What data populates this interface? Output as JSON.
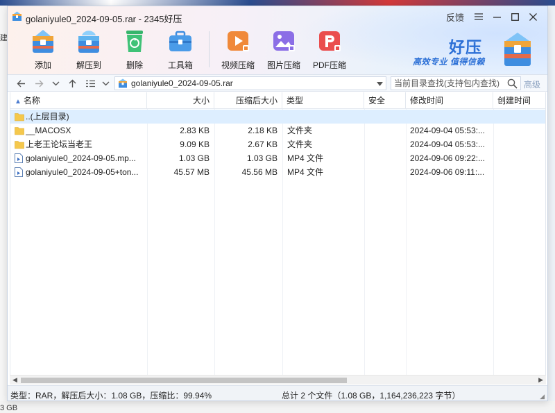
{
  "desktop": {
    "left_text": "建",
    "bottom_text": "3 GB"
  },
  "window": {
    "title": "golaniyule0_2024-09-05.rar - 2345好压",
    "feedback": "反馈"
  },
  "toolbar": {
    "items": [
      {
        "label": "添加",
        "icon": "add-archive-icon"
      },
      {
        "label": "解压到",
        "icon": "extract-icon"
      },
      {
        "label": "删除",
        "icon": "recycle-delete-icon"
      },
      {
        "label": "工具箱",
        "icon": "toolbox-icon"
      },
      {
        "label": "视频压缩",
        "icon": "video-compress-icon"
      },
      {
        "label": "图片压缩",
        "icon": "image-compress-icon"
      },
      {
        "label": "PDF压缩",
        "icon": "pdf-compress-icon"
      }
    ]
  },
  "brand": {
    "name": "好压",
    "slogan": "高效专业  值得信赖"
  },
  "addressbar": {
    "path": "golaniyule0_2024-09-05.rar",
    "search_placeholder": "当前目录查找(支持包内查找)",
    "advanced": "高级"
  },
  "columns": {
    "name": "名称",
    "size": "大小",
    "packed": "压缩后大小",
    "type": "类型",
    "security": "安全",
    "modified": "修改时间",
    "created": "创建时间"
  },
  "rows": [
    {
      "icon": "folder",
      "name": "..(上层目录)",
      "size": "",
      "packed": "",
      "type": "",
      "security": "",
      "modified": "",
      "created": ""
    },
    {
      "icon": "folder",
      "name": "__MACOSX",
      "size": "2.83 KB",
      "packed": "2.18 KB",
      "type": "文件夹",
      "security": "",
      "modified": "2024-09-04 05:53:...",
      "created": ""
    },
    {
      "icon": "folder",
      "name": "上老王论坛当老王",
      "size": "9.09 KB",
      "packed": "2.67 KB",
      "type": "文件夹",
      "security": "",
      "modified": "2024-09-04 05:53:...",
      "created": ""
    },
    {
      "icon": "file",
      "name": "golaniyule0_2024-09-05.mp...",
      "size": "1.03 GB",
      "packed": "1.03 GB",
      "type": "MP4 文件",
      "security": "",
      "modified": "2024-09-06 09:22:...",
      "created": ""
    },
    {
      "icon": "file",
      "name": "golaniyule0_2024-09-05+ton...",
      "size": "45.57 MB",
      "packed": "45.56 MB",
      "type": "MP4 文件",
      "security": "",
      "modified": "2024-09-06 09:11:...",
      "created": ""
    }
  ],
  "status": {
    "left": "类型：RAR，解压后大小：1.08 GB，压缩比：99.94%",
    "right": "总计 2 个文件（1.08 GB，1,164,236,223 字节）"
  },
  "colors": {
    "accent": "#2b6fd6",
    "selected_row": "#ddeeff",
    "folder": "#f5c84c"
  }
}
